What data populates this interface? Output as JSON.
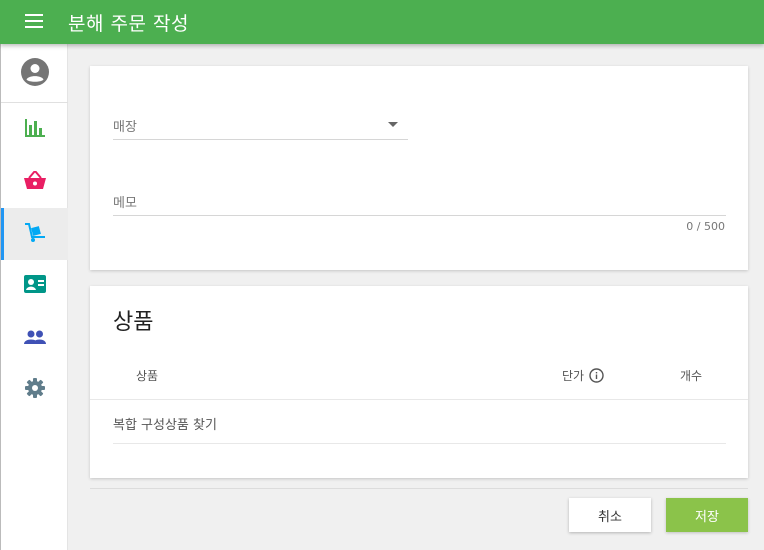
{
  "appbar": {
    "title": "분해 주문 작성",
    "bg_color": "#4caf50",
    "menu_icon": "hamburger-menu-icon"
  },
  "sidebar": {
    "active_index": 3,
    "active_indicator_color": "#2196f3",
    "items": [
      {
        "icon": "account-circle-icon",
        "color": "#757575"
      },
      {
        "icon": "bar-chart-icon",
        "color": "#4caf50"
      },
      {
        "icon": "shopping-basket-icon",
        "color": "#e91e63"
      },
      {
        "icon": "dolly-cart-icon",
        "color": "#03a9f4"
      },
      {
        "icon": "contact-card-icon",
        "color": "#009688"
      },
      {
        "icon": "people-icon",
        "color": "#3f51b5"
      },
      {
        "icon": "settings-gear-icon",
        "color": "#607d8b"
      }
    ]
  },
  "form": {
    "store_label": "매장",
    "memo_placeholder": "메모",
    "memo_value": "",
    "memo_counter": "0 / 500"
  },
  "products": {
    "title": "상품",
    "columns": [
      "상품",
      "단가",
      "개수"
    ],
    "price_info_icon": "info-outline-icon",
    "search_placeholder": "복합 구성상품 찾기"
  },
  "actions": {
    "cancel_label": "취소",
    "save_label": "저장",
    "save_color": "#8bc34a"
  }
}
